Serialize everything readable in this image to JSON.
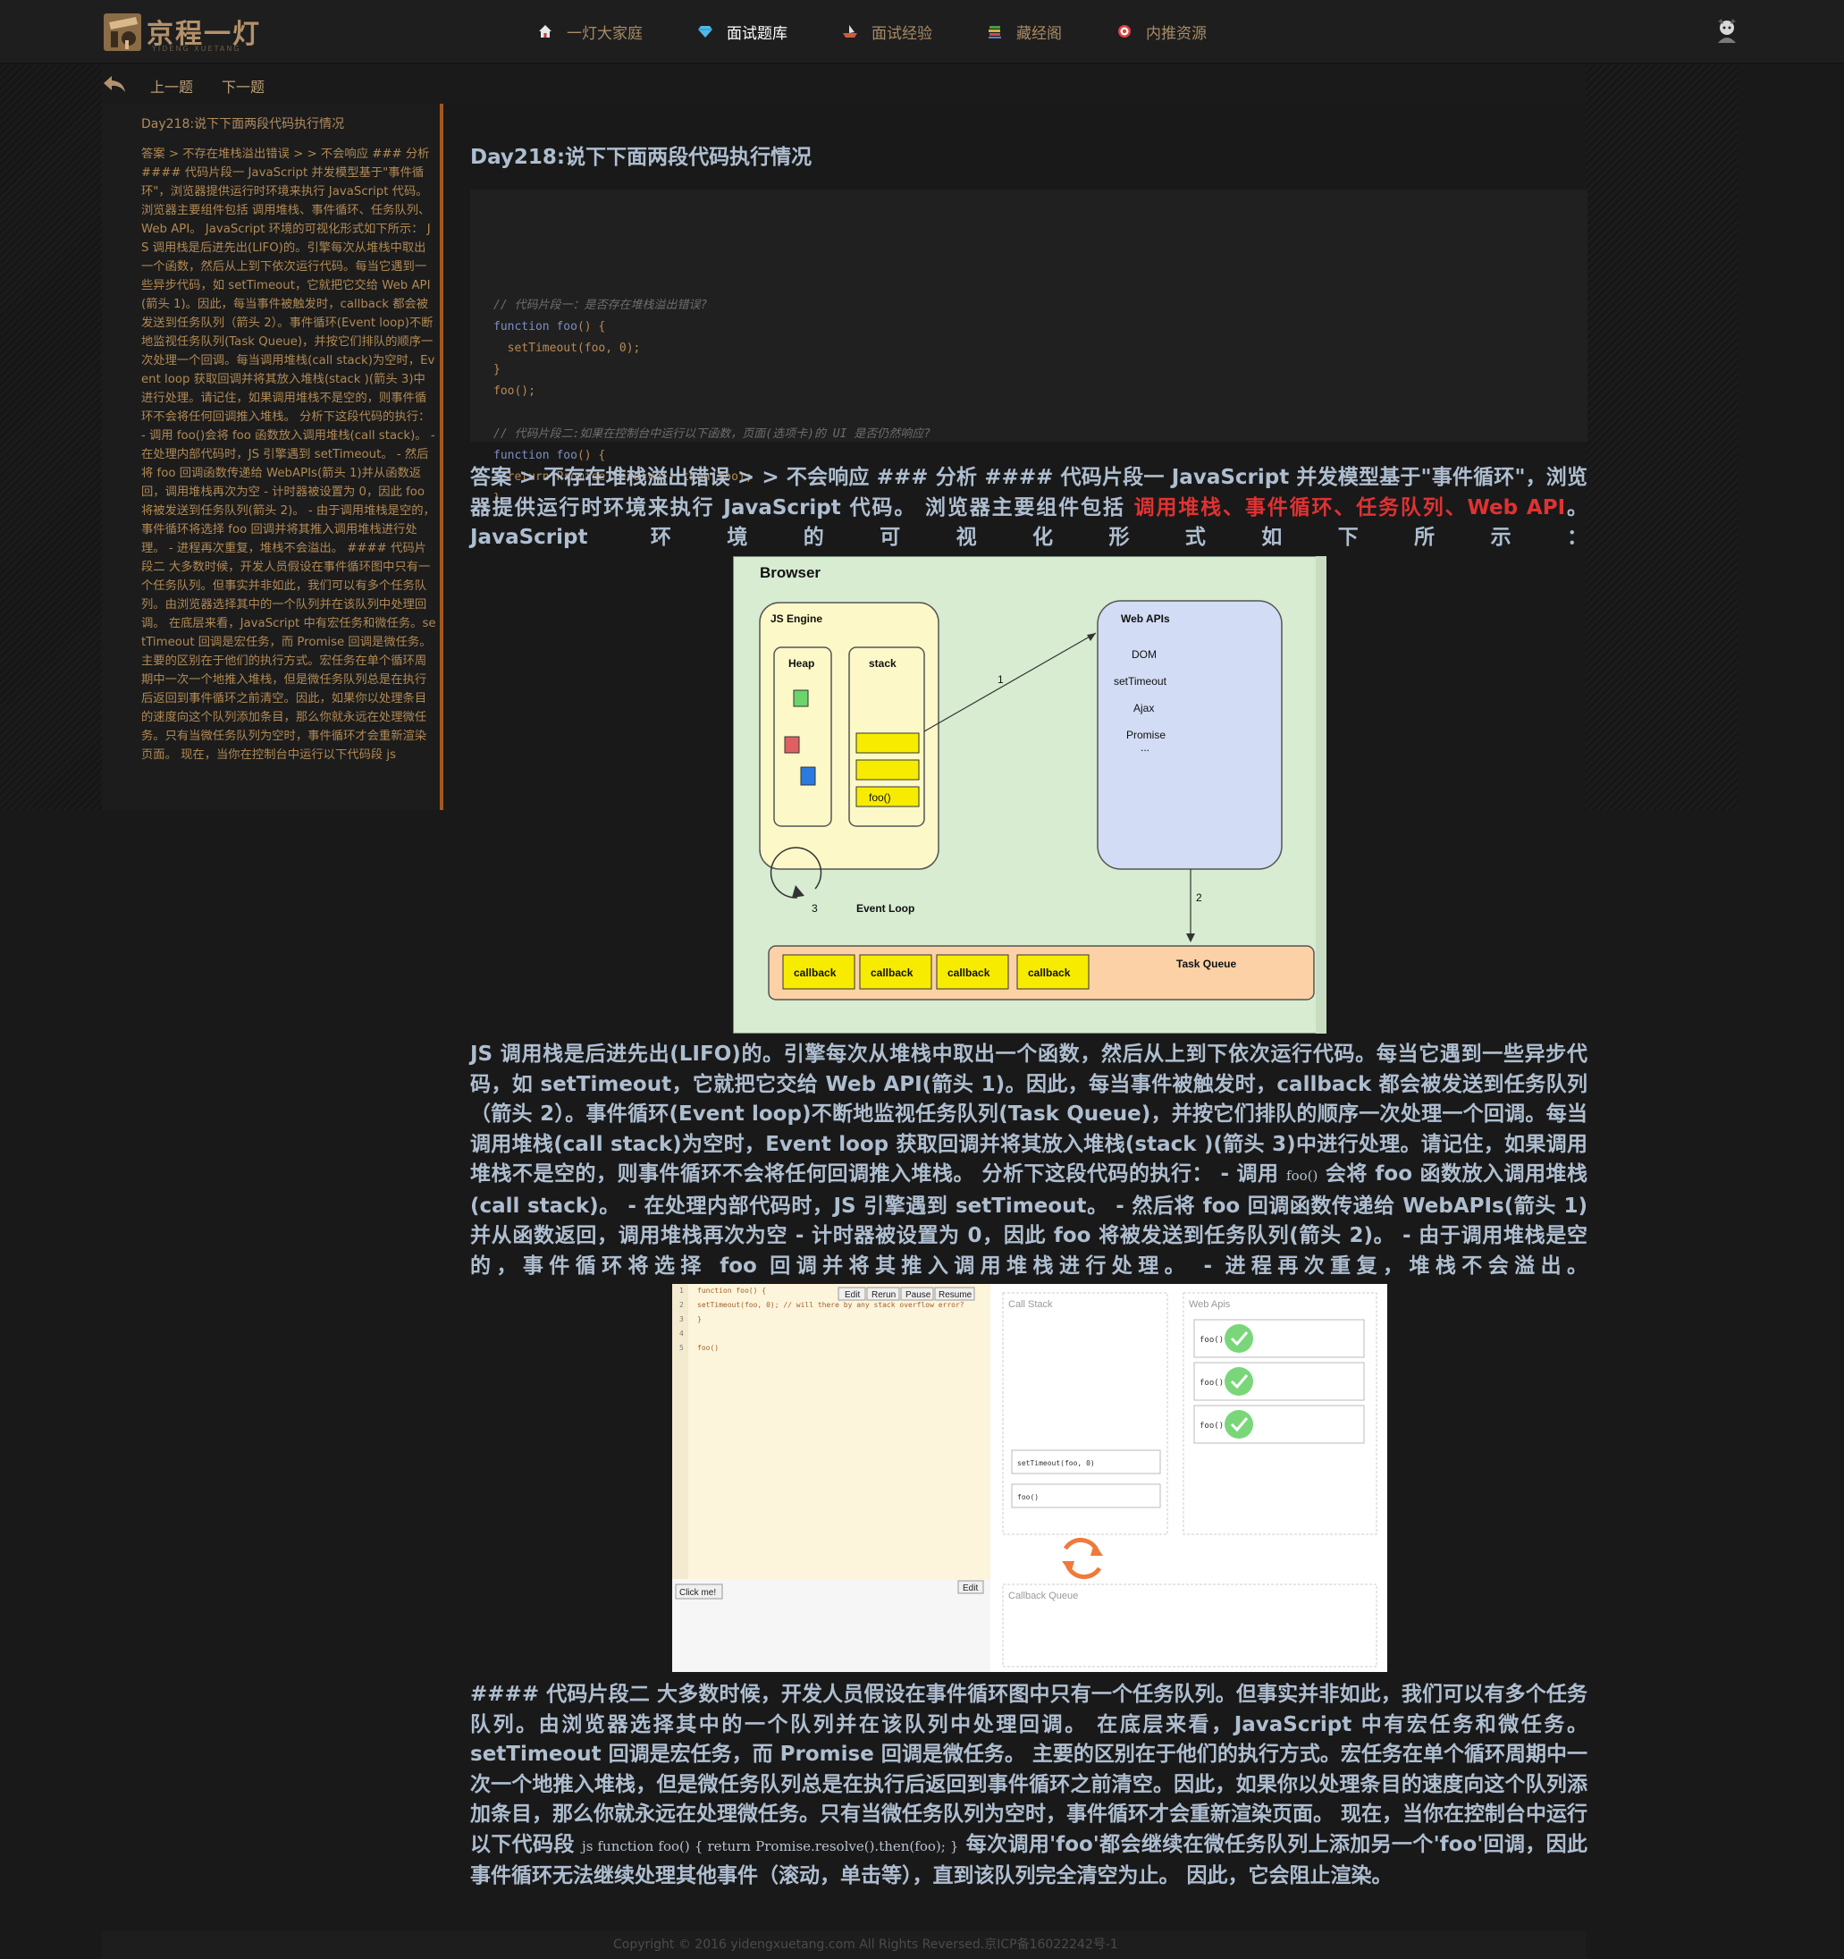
{
  "nav": {
    "brand": "京程一灯",
    "brand_sub": "YIDENG XUETANG",
    "items": [
      {
        "label": "一灯大家庭",
        "icon": "home-icon",
        "active": false
      },
      {
        "label": "面试题库",
        "icon": "diamond-icon",
        "active": true
      },
      {
        "label": "面试经验",
        "icon": "boat-icon",
        "active": false
      },
      {
        "label": "藏经阁",
        "icon": "book-stack-icon",
        "active": false
      },
      {
        "label": "内推资源",
        "icon": "target-icon",
        "active": false
      }
    ]
  },
  "subnav": {
    "prev": "上一题",
    "next": "下一题"
  },
  "sidebar": {
    "title": "Day218:说下下面两段代码执行情况",
    "body": "答案 > 不存在堆栈溢出错误 > > 不会响应 ### 分析 #### 代码片段一 JavaScript 并发模型基于\"事件循环\"，浏览器提供运行时环境来执行 JavaScript 代码。 浏览器主要组件包括 调用堆栈、事件循环、任务队列、Web API。 JavaScript 环境的可视化形式如下所示： JS 调用栈是后进先出(LIFO)的。引擎每次从堆栈中取出一个函数，然后从上到下依次运行代码。每当它遇到一些异步代码，如 setTimeout，它就把它交给 Web API(箭头 1)。因此，每当事件被触发时，callback 都会被发送到任务队列（箭头 2）。事件循环(Event loop)不断地监视任务队列(Task Queue)，并按它们排队的顺序一次处理一个回调。每当调用堆栈(call stack)为空时，Event loop 获取回调并将其放入堆栈(stack )(箭头 3)中进行处理。请记住，如果调用堆栈不是空的，则事件循环不会将任何回调推入堆栈。 分析下这段代码的执行： - 调用 foo()会将 foo 函数放入调用堆栈(call stack)。 - 在处理内部代码时，JS 引擎遇到 setTimeout。 - 然后将 foo 回调函数传递给 WebAPIs(箭头 1)并从函数返回，调用堆栈再次为空 - 计时器被设置为 0，因此 foo 将被发送到任务队列(箭头 2)。 - 由于调用堆栈是空的，事件循环将选择 foo 回调并将其推入调用堆栈进行处理。 - 进程再次重复，堆栈不会溢出。 #### 代码片段二 大多数时候，开发人员假设在事件循环图中只有一个任务队列。但事实并非如此，我们可以有多个任务队列。由浏览器选择其中的一个队列并在该队列中处理回调。 在底层来看，JavaScript 中有宏任务和微任务。setTimeout 回调是宏任务，而 Promise 回调是微任务。 主要的区别在于他们的执行方式。宏任务在单个循环周期中一次一个地推入堆栈，但是微任务队列总是在执行后返回到事件循环之前清空。因此，如果你以处理条目的速度向这个队列添加条目，那么你就永远在处理微任务。只有当微任务队列为空时，事件循环才会重新渲染页面。 现在，当你在控制台中运行以下代码段 js"
  },
  "main": {
    "title": "Day218:说下下面两段代码执行情况",
    "code_lines": [
      "// 代码片段一：是否存在堆栈溢出错误?",
      "function foo() {",
      "  setTimeout(foo, 0);",
      "}",
      "foo();",
      "",
      "// 代码片段二:如果在控制台中运行以下函数，页面(选项卡)的 UI 是否仍然响应?",
      "function foo() {",
      "  return Promise.resolve().then(foo);",
      "}"
    ],
    "p1_before": "答案 > 不存在堆栈溢出错误 > > 不会响应 ### 分析 #### 代码片段一 JavaScript 并发模型基于\"事件循环\"，浏览器提供运行时环境来执行 JavaScript 代码。 浏览器主要组件包括 ",
    "p1_red": "调用堆栈、事件循环、任务队列、Web API",
    "p1_after": "。 JavaScript 环境的可视化形式如下所示：",
    "p2_a": "JS 调用栈是后进先出(LIFO)的。引擎每次从堆栈中取出一个函数，然后从上到下依次运行代码。每当它遇到一些异步代码，如 setTimeout，它就把它交给 Web API(箭头 1)。因此，每当事件被触发时，callback 都会被发送到任务队列（箭头 2）。事件循环(Event loop)不断地监视任务队列(Task Queue)，并按它们排队的顺序一次处理一个回调。每当调用堆栈(call stack)为空时，Event loop 获取回调并将其放入堆栈(stack )(箭头 3)中进行处理。请记住，如果调用堆栈不是空的，则事件循环不会将任何回调推入堆栈。 分析下这段代码的执行： - 调用 ",
    "p2_code": "foo()",
    "p2_b": " 会将 foo 函数放入调用堆栈(call stack)。 - 在处理内部代码时，JS 引擎遇到 setTimeout。 - 然后将 foo 回调函数传递给 WebAPIs(箭头 1)并从函数返回，调用堆栈再次为空 - 计时器被设置为 0，因此 foo 将被发送到任务队列(箭头 2)。 - 由于调用堆栈是空的，事件循环将选择 foo 回调并将其推入调用堆栈进行处理。 - 进程再次重复，堆栈不会溢出。",
    "p3_a": "#### 代码片段二 大多数时候，开发人员假设在事件循环图中只有一个任务队列。但事实并非如此，我们可以有多个任务队列。由浏览器选择其中的一个队列并在该队列中处理回调。 在底层来看，JavaScript 中有宏任务和微任务。setTimeout 回调是宏任务，而 Promise 回调是微任务。 主要的区别在于他们的执行方式。宏任务在单个循环周期中一次一个地推入堆栈，但是微任务队列总是在执行后返回到事件循环之前清空。因此，如果你以处理条目的速度向这个队列添加条目，那么你就永远在处理微任务。只有当微任务队列为空时，事件循环才会重新渲染页面。 现在，当你在控制台中运行以下代码段 ",
    "p3_code": "js function foo() { return Promise.resolve().then(foo); }",
    "p3_b": " 每次调用'foo'都会继续在微任务队列上添加另一个'foo'回调，因此事件循环无法继续处理其他事件（滚动，单击等），直到该队列完全清空为止。 因此，它会阻止渲染。"
  },
  "diagram1": {
    "browser": "Browser",
    "js_engine": "JS Engine",
    "heap": "Heap",
    "stack": "stack",
    "stack_item": "foo()",
    "web_apis": "Web APIs",
    "api_items": [
      "DOM",
      "setTimeout",
      "Ajax",
      "Promise",
      "..."
    ],
    "arrow1": "1",
    "arrow2": "2",
    "loop_num": "3",
    "event_loop": "Event Loop",
    "task_queue": "Task Queue",
    "callbacks": [
      "callback",
      "callback",
      "callback",
      "callback"
    ]
  },
  "diagram2": {
    "code_lines": [
      "function foo() {",
      "  setTimeout(foo, 0); // will there by any stack overflow error?",
      "}",
      "",
      "foo()"
    ],
    "line_numbers": [
      "1",
      "2",
      "3",
      "4",
      "5"
    ],
    "buttons": [
      "Edit",
      "Rerun",
      "Pause",
      "Resume"
    ],
    "call_stack": "Call Stack",
    "stack_items": [
      "setTimeout(foo, 0)",
      "foo()"
    ],
    "web_apis": "Web Apis",
    "api_items": [
      "foo()",
      "foo()",
      "foo()"
    ],
    "click_me": "Click me!",
    "edit": "Edit",
    "callback_queue": "Callback Queue"
  },
  "footer": "Copyright © 2016 yidengxuetang.com All Rights Reversed.京ICP备16022242号-1"
}
